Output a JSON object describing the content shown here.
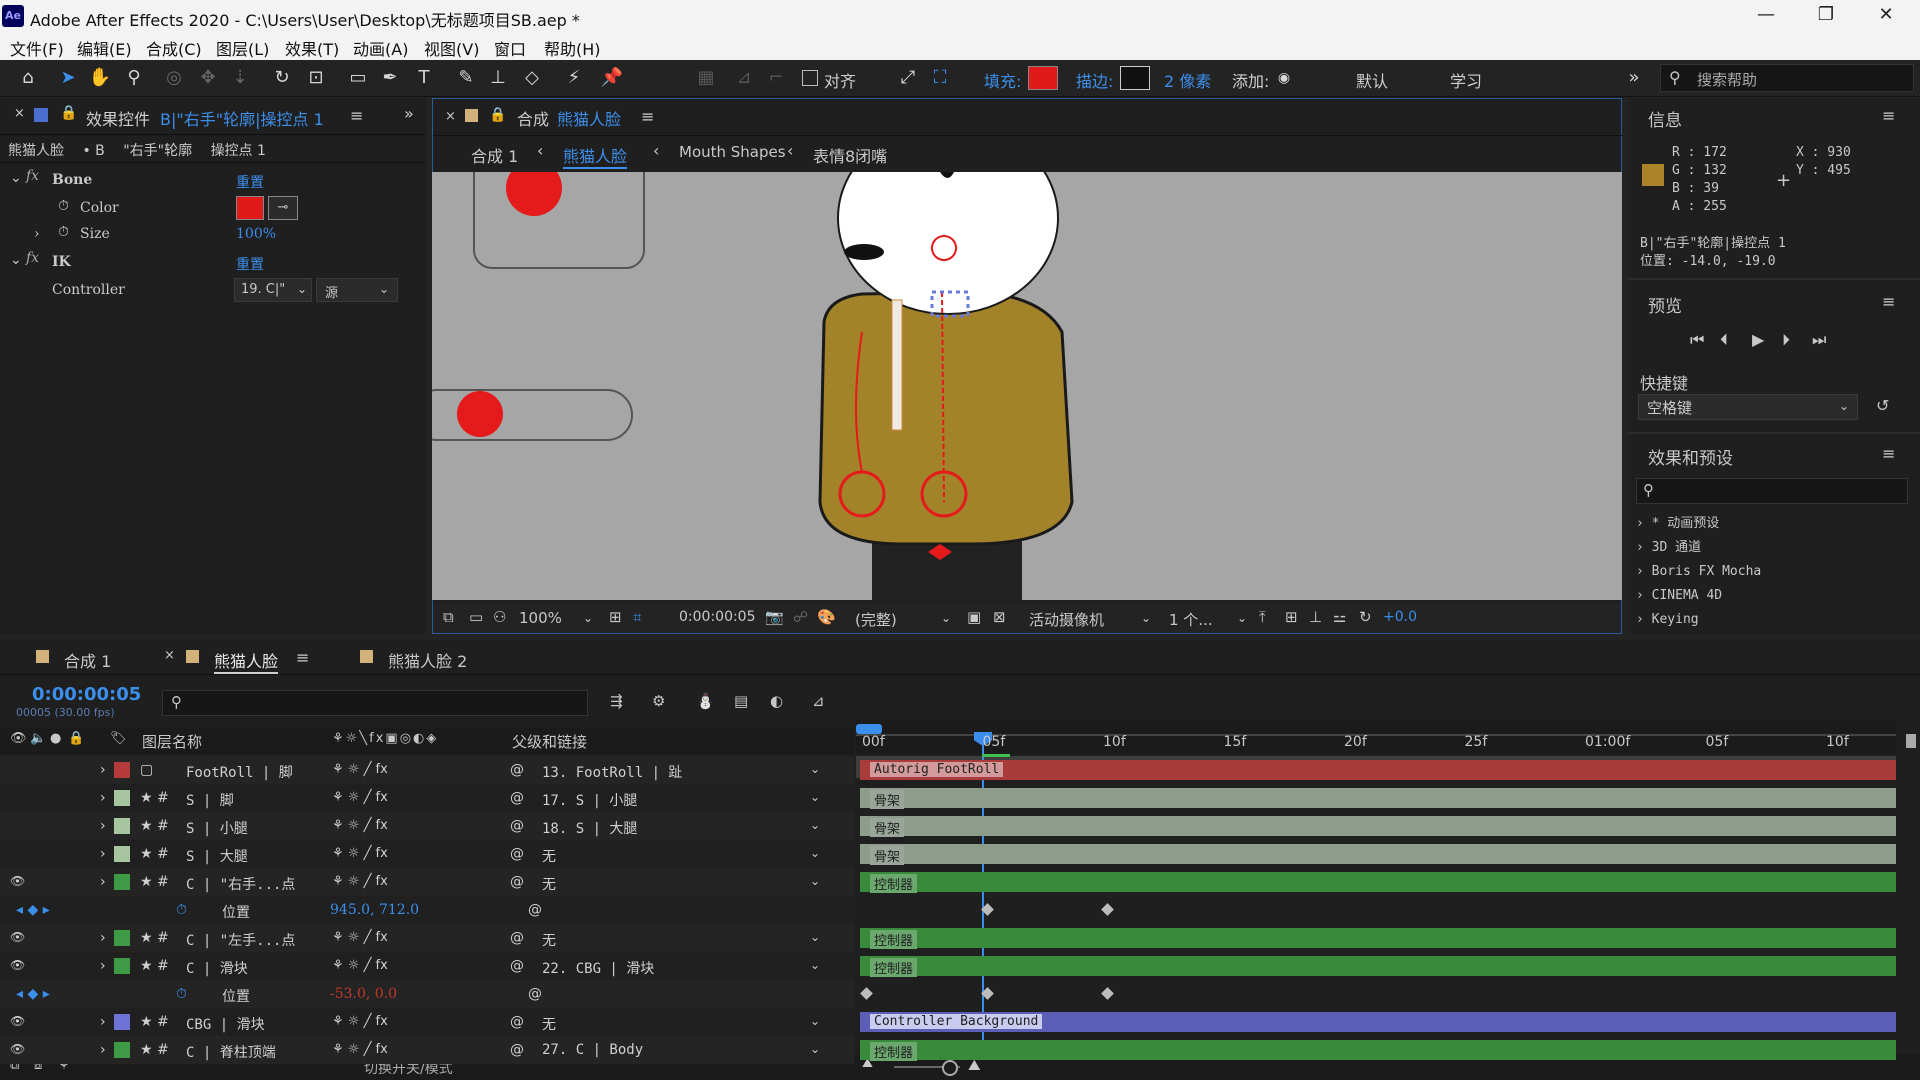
{
  "window": {
    "title": "Adobe After Effects 2020 - C:\\Users\\User\\Desktop\\无标题项目SB.aep *",
    "app_icon": "Ae"
  },
  "menu": [
    "文件(F)",
    "编辑(E)",
    "合成(C)",
    "图层(L)",
    "效果(T)",
    "动画(A)",
    "视图(V)",
    "窗口",
    "帮助(H)"
  ],
  "toolbar": {
    "align_label": "对齐",
    "fill_label": "填充:",
    "stroke_label": "描边:",
    "stroke_px": "2 像素",
    "add_label": "添加:",
    "workspace_default": "默认",
    "workspace_learn": "学习",
    "search_placeholder": "搜索帮助",
    "fill_color": "#e0191b",
    "stroke_color": "#111111"
  },
  "effects_panel": {
    "tab": "效果控件",
    "tab_target": "B|\"右手\"轮廓|操控点 1",
    "breadcrumb": [
      "熊猫人脸",
      "• B",
      "\"右手\"轮廓",
      "操控点 1"
    ],
    "bone_label": "Bone",
    "bone_reset": "重置",
    "color_label": "Color",
    "size_label": "Size",
    "size_value": "100%",
    "ik_label": "IK",
    "ik_reset": "重置",
    "controller_label": "Controller",
    "controller_value": "19. C|\"",
    "controller_source": "源"
  },
  "comp_panel": {
    "tab_prefix": "合成",
    "tab_name": "熊猫人脸",
    "breadcrumbs": [
      "合成 1",
      "熊猫人脸",
      "Mouth Shapes",
      "表情8闭嘴"
    ],
    "zoom": "100%",
    "timecode": "0:00:00:05",
    "quality": "(完整)",
    "camera": "活动摄像机",
    "views": "1 个...",
    "exposure": "+0.0"
  },
  "info_panel": {
    "title": "信息",
    "r": "R : 172",
    "g": "G : 132",
    "b": "B : 39",
    "a": "A : 255",
    "x": "X : 930",
    "y": "Y : 495",
    "swatch": "#ac8427",
    "layer": "B|\"右手\"轮廓|操控点 1",
    "position": "位置: -14.0, -19.0"
  },
  "preview_panel": {
    "title": "预览",
    "shortcut_label": "快捷键",
    "shortcut_value": "空格键"
  },
  "presets_panel": {
    "title": "效果和预设",
    "items": [
      "* 动画预设",
      "3D 通道",
      "Boris FX Mocha",
      "CINEMA 4D",
      "Keying"
    ]
  },
  "timeline": {
    "tabs": [
      "合成 1",
      "熊猫人脸",
      "熊猫人脸 2"
    ],
    "timecode": "0:00:00:05",
    "fps": "00005 (30.00 fps)",
    "col_layer_name": "图层名称",
    "col_parent": "父级和链接",
    "ruler": [
      "00f",
      "05f",
      "10f",
      "15f",
      "20f",
      "25f",
      "01:00f",
      "05f",
      "10f"
    ],
    "footer": "切换开关/模式",
    "layers": [
      {
        "name": "FootRoll | 脚",
        "parent": "13. FootRoll | 趾",
        "label": "#b53a3a",
        "bar": "Autorig FootRoll",
        "bar_color": "#a93b3b"
      },
      {
        "name": "S | 脚",
        "parent": "17. S | 小腿",
        "label": "#a7c6a0",
        "bar": "骨架",
        "bar_color": "#8e9c8c"
      },
      {
        "name": "S | 小腿",
        "parent": "18. S | 大腿",
        "label": "#a7c6a0",
        "bar": "骨架",
        "bar_color": "#8e9c8c"
      },
      {
        "name": "S | 大腿",
        "parent": "无",
        "label": "#a7c6a0",
        "bar": "骨架",
        "bar_color": "#8e9c8c"
      },
      {
        "name": "C | \"右手...点",
        "parent": "无",
        "label": "#3f9a46",
        "bar": "控制器",
        "bar_color": "#3a8a3c"
      },
      {
        "name": "位置",
        "value": "945.0, 712.0",
        "sub": true
      },
      {
        "name": "C | \"左手...点",
        "parent": "无",
        "label": "#3f9a46",
        "bar": "控制器",
        "bar_color": "#3a8a3c"
      },
      {
        "name": "C | 滑块",
        "parent": "22. CBG | 滑块",
        "label": "#3f9a46",
        "bar": "控制器",
        "bar_color": "#3a8a3c"
      },
      {
        "name": "位置",
        "value": "-53.0, 0.0",
        "sub": true
      },
      {
        "name": "CBG | 滑块",
        "parent": "无",
        "label": "#6d73d6",
        "bar": "Controller Background",
        "bar_color": "#5b5fb8"
      },
      {
        "name": "C | 脊柱顶端",
        "parent": "27. C | Body",
        "label": "#3f9a46",
        "bar": "控制器",
        "bar_color": "#3a8a3c"
      }
    ]
  }
}
